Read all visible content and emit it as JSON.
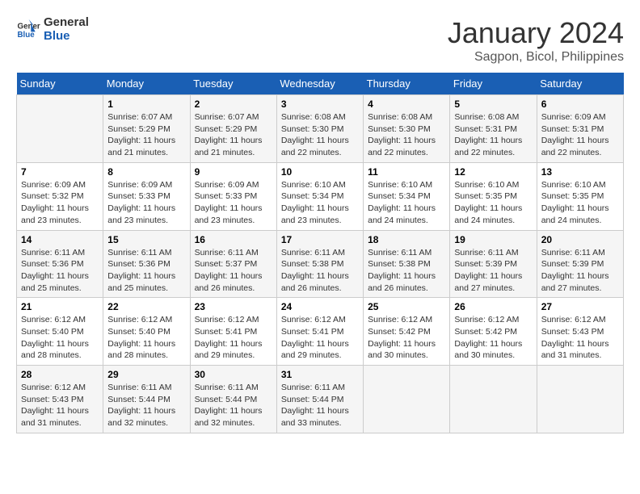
{
  "header": {
    "logo_line1": "General",
    "logo_line2": "Blue",
    "main_title": "January 2024",
    "subtitle": "Sagpon, Bicol, Philippines"
  },
  "days_of_week": [
    "Sunday",
    "Monday",
    "Tuesday",
    "Wednesday",
    "Thursday",
    "Friday",
    "Saturday"
  ],
  "weeks": [
    [
      {
        "day": "",
        "sunrise": "",
        "sunset": "",
        "daylight": ""
      },
      {
        "day": "1",
        "sunrise": "Sunrise: 6:07 AM",
        "sunset": "Sunset: 5:29 PM",
        "daylight": "Daylight: 11 hours and 21 minutes."
      },
      {
        "day": "2",
        "sunrise": "Sunrise: 6:07 AM",
        "sunset": "Sunset: 5:29 PM",
        "daylight": "Daylight: 11 hours and 21 minutes."
      },
      {
        "day": "3",
        "sunrise": "Sunrise: 6:08 AM",
        "sunset": "Sunset: 5:30 PM",
        "daylight": "Daylight: 11 hours and 22 minutes."
      },
      {
        "day": "4",
        "sunrise": "Sunrise: 6:08 AM",
        "sunset": "Sunset: 5:30 PM",
        "daylight": "Daylight: 11 hours and 22 minutes."
      },
      {
        "day": "5",
        "sunrise": "Sunrise: 6:08 AM",
        "sunset": "Sunset: 5:31 PM",
        "daylight": "Daylight: 11 hours and 22 minutes."
      },
      {
        "day": "6",
        "sunrise": "Sunrise: 6:09 AM",
        "sunset": "Sunset: 5:31 PM",
        "daylight": "Daylight: 11 hours and 22 minutes."
      }
    ],
    [
      {
        "day": "7",
        "sunrise": "Sunrise: 6:09 AM",
        "sunset": "Sunset: 5:32 PM",
        "daylight": "Daylight: 11 hours and 23 minutes."
      },
      {
        "day": "8",
        "sunrise": "Sunrise: 6:09 AM",
        "sunset": "Sunset: 5:33 PM",
        "daylight": "Daylight: 11 hours and 23 minutes."
      },
      {
        "day": "9",
        "sunrise": "Sunrise: 6:09 AM",
        "sunset": "Sunset: 5:33 PM",
        "daylight": "Daylight: 11 hours and 23 minutes."
      },
      {
        "day": "10",
        "sunrise": "Sunrise: 6:10 AM",
        "sunset": "Sunset: 5:34 PM",
        "daylight": "Daylight: 11 hours and 23 minutes."
      },
      {
        "day": "11",
        "sunrise": "Sunrise: 6:10 AM",
        "sunset": "Sunset: 5:34 PM",
        "daylight": "Daylight: 11 hours and 24 minutes."
      },
      {
        "day": "12",
        "sunrise": "Sunrise: 6:10 AM",
        "sunset": "Sunset: 5:35 PM",
        "daylight": "Daylight: 11 hours and 24 minutes."
      },
      {
        "day": "13",
        "sunrise": "Sunrise: 6:10 AM",
        "sunset": "Sunset: 5:35 PM",
        "daylight": "Daylight: 11 hours and 24 minutes."
      }
    ],
    [
      {
        "day": "14",
        "sunrise": "Sunrise: 6:11 AM",
        "sunset": "Sunset: 5:36 PM",
        "daylight": "Daylight: 11 hours and 25 minutes."
      },
      {
        "day": "15",
        "sunrise": "Sunrise: 6:11 AM",
        "sunset": "Sunset: 5:36 PM",
        "daylight": "Daylight: 11 hours and 25 minutes."
      },
      {
        "day": "16",
        "sunrise": "Sunrise: 6:11 AM",
        "sunset": "Sunset: 5:37 PM",
        "daylight": "Daylight: 11 hours and 26 minutes."
      },
      {
        "day": "17",
        "sunrise": "Sunrise: 6:11 AM",
        "sunset": "Sunset: 5:38 PM",
        "daylight": "Daylight: 11 hours and 26 minutes."
      },
      {
        "day": "18",
        "sunrise": "Sunrise: 6:11 AM",
        "sunset": "Sunset: 5:38 PM",
        "daylight": "Daylight: 11 hours and 26 minutes."
      },
      {
        "day": "19",
        "sunrise": "Sunrise: 6:11 AM",
        "sunset": "Sunset: 5:39 PM",
        "daylight": "Daylight: 11 hours and 27 minutes."
      },
      {
        "day": "20",
        "sunrise": "Sunrise: 6:11 AM",
        "sunset": "Sunset: 5:39 PM",
        "daylight": "Daylight: 11 hours and 27 minutes."
      }
    ],
    [
      {
        "day": "21",
        "sunrise": "Sunrise: 6:12 AM",
        "sunset": "Sunset: 5:40 PM",
        "daylight": "Daylight: 11 hours and 28 minutes."
      },
      {
        "day": "22",
        "sunrise": "Sunrise: 6:12 AM",
        "sunset": "Sunset: 5:40 PM",
        "daylight": "Daylight: 11 hours and 28 minutes."
      },
      {
        "day": "23",
        "sunrise": "Sunrise: 6:12 AM",
        "sunset": "Sunset: 5:41 PM",
        "daylight": "Daylight: 11 hours and 29 minutes."
      },
      {
        "day": "24",
        "sunrise": "Sunrise: 6:12 AM",
        "sunset": "Sunset: 5:41 PM",
        "daylight": "Daylight: 11 hours and 29 minutes."
      },
      {
        "day": "25",
        "sunrise": "Sunrise: 6:12 AM",
        "sunset": "Sunset: 5:42 PM",
        "daylight": "Daylight: 11 hours and 30 minutes."
      },
      {
        "day": "26",
        "sunrise": "Sunrise: 6:12 AM",
        "sunset": "Sunset: 5:42 PM",
        "daylight": "Daylight: 11 hours and 30 minutes."
      },
      {
        "day": "27",
        "sunrise": "Sunrise: 6:12 AM",
        "sunset": "Sunset: 5:43 PM",
        "daylight": "Daylight: 11 hours and 31 minutes."
      }
    ],
    [
      {
        "day": "28",
        "sunrise": "Sunrise: 6:12 AM",
        "sunset": "Sunset: 5:43 PM",
        "daylight": "Daylight: 11 hours and 31 minutes."
      },
      {
        "day": "29",
        "sunrise": "Sunrise: 6:11 AM",
        "sunset": "Sunset: 5:44 PM",
        "daylight": "Daylight: 11 hours and 32 minutes."
      },
      {
        "day": "30",
        "sunrise": "Sunrise: 6:11 AM",
        "sunset": "Sunset: 5:44 PM",
        "daylight": "Daylight: 11 hours and 32 minutes."
      },
      {
        "day": "31",
        "sunrise": "Sunrise: 6:11 AM",
        "sunset": "Sunset: 5:44 PM",
        "daylight": "Daylight: 11 hours and 33 minutes."
      },
      {
        "day": "",
        "sunrise": "",
        "sunset": "",
        "daylight": ""
      },
      {
        "day": "",
        "sunrise": "",
        "sunset": "",
        "daylight": ""
      },
      {
        "day": "",
        "sunrise": "",
        "sunset": "",
        "daylight": ""
      }
    ]
  ]
}
